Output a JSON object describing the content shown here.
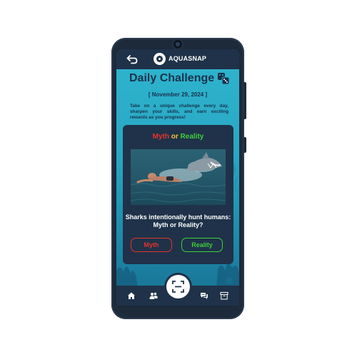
{
  "app": {
    "brand": "AQUASNAP"
  },
  "header": {
    "title": "Daily Challenge",
    "date": "[ November 29, 2024 ]",
    "description": "Take on a unique challenge every day, sharpen your skills, and earn exciting rewards as you progress!"
  },
  "challenge": {
    "title_parts": {
      "myth": "Myth",
      "or": " or ",
      "reality": "Reality"
    },
    "image_alt": "Shark approaching a swimmer",
    "question": "Sharks intentionally hunt humans: Myth or Reality?",
    "buttons": {
      "myth": "Myth",
      "reality": "Reality"
    }
  },
  "nav": {
    "items": [
      "home-icon",
      "community-icon",
      "scan-icon",
      "chat-icon",
      "archive-icon"
    ]
  },
  "colors": {
    "myth": "#e5332a",
    "or": "#f1c232",
    "reality": "#3fcf3b",
    "navy": "#1f3249",
    "aqua": "#2fb6cf"
  }
}
